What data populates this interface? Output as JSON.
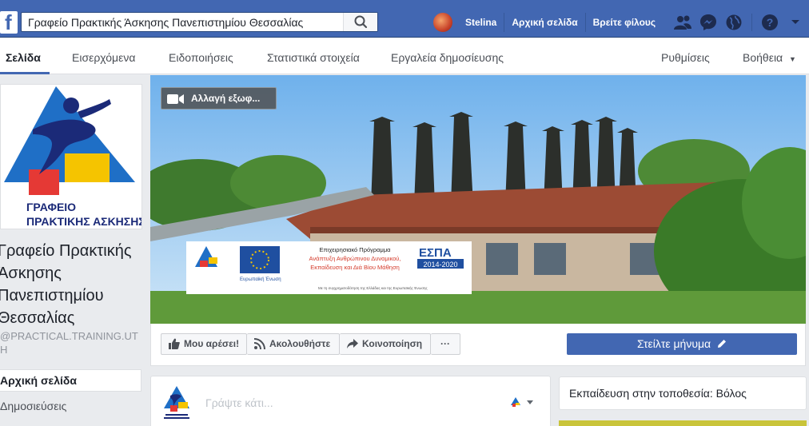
{
  "topbar": {
    "search_value": "Γραφείο Πρακτικής Άσκησης Πανεπιστημίου Θεσσαλίας",
    "user_name": "Stelina",
    "home_label": "Αρχική σελίδα",
    "find_friends_label": "Βρείτε φίλους",
    "icons": [
      "facebook-logo",
      "search-icon",
      "friend-requests-icon",
      "messenger-icon",
      "notifications-globe-icon",
      "help-icon",
      "chevron-down-icon"
    ]
  },
  "tabs": {
    "page": "Σελίδα",
    "inbox": "Εισερχόμενα",
    "notifications": "Ειδοποιήσεις",
    "insights": "Στατιστικά στοιχεία",
    "publishing_tools": "Εργαλεία δημοσίευσης",
    "settings": "Ρυθμίσεις",
    "help": "Βοήθεια"
  },
  "profile": {
    "logo_line1": "ΓΡΑΦΕΙΟ",
    "logo_line2": "ΠΡΑΚΤΙΚΗΣ ΑΣΚΗΣΗΣ",
    "name": "Γραφείο Πρακτικής Άσκησης Πανεπιστημίου Θεσσαλίας",
    "handle": "@PRACTICAL.TRAINING.UTH"
  },
  "leftnav": {
    "home": "Αρχική σελίδα",
    "posts": "Δημοσιεύσεις"
  },
  "cover": {
    "change_cover_label": "Αλλαγή εξωφ...",
    "banner": {
      "program_line1": "Επιχειρησιακό Πρόγραμμα",
      "program_line2": "Ανάπτυξη Ανθρώπινου Δυναμικού,",
      "program_line3": "Εκπαίδευση και Διά Βίου Μάθηση",
      "eu_label": "Ευρωπαϊκή Ένωση",
      "espa_label": "ΕΣΠΑ",
      "espa_years": "2014-2020",
      "footer_text": "Με τη συγχρηματοδότηση της Ελλάδας και της Ευρωπαϊκής Ένωσης"
    }
  },
  "actions": {
    "like": "Μου αρέσει!",
    "follow": "Ακολουθήστε",
    "share": "Κοινοποίηση",
    "more": "···",
    "message": "Στείλτε μήνυμα"
  },
  "composer": {
    "placeholder": "Γράψτε κάτι..."
  },
  "right": {
    "education_text": "Εκπαίδευση στην τοποθεσία: Βόλος"
  },
  "colors": {
    "brand_blue": "#4267b2",
    "background": "#e9ebee",
    "logo_blue": "#1f6fc6",
    "logo_navy": "#1b2a78",
    "logo_red": "#e53935",
    "logo_yellow": "#f5c400"
  }
}
